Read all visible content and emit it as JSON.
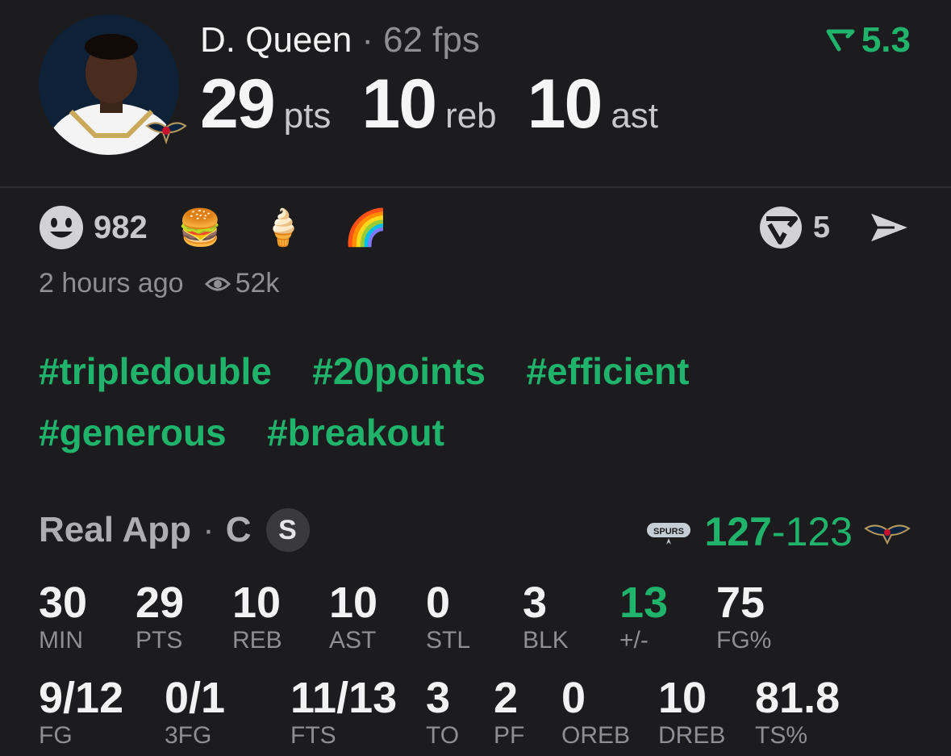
{
  "player": {
    "name": "D. Queen",
    "fps": "62 fps",
    "rating": "5.3",
    "pts": "29",
    "pts_unit": "pts",
    "reb": "10",
    "reb_unit": "reb",
    "ast": "10",
    "ast_unit": "ast"
  },
  "reactions": {
    "count": "982",
    "emojis": [
      "🍔",
      "🍦",
      "🌈"
    ],
    "shares": "5"
  },
  "meta": {
    "time": "2 hours ago",
    "views": "52k"
  },
  "tags": [
    "#tripledouble",
    "#20points",
    "#efficient",
    "#generous",
    "#breakout"
  ],
  "game": {
    "source": "Real App",
    "position": "C",
    "badge": "S",
    "score_home": "127",
    "score_away": "123",
    "spurs_logo_text": "SPURS"
  },
  "stats_row1": [
    {
      "value": "30",
      "label": "MIN"
    },
    {
      "value": "29",
      "label": "PTS"
    },
    {
      "value": "10",
      "label": "REB"
    },
    {
      "value": "10",
      "label": "AST"
    },
    {
      "value": "0",
      "label": "STL"
    },
    {
      "value": "3",
      "label": "BLK"
    },
    {
      "value": "13",
      "label": "+/-"
    },
    {
      "value": "75",
      "label": "FG%"
    }
  ],
  "stats_row2": [
    {
      "value": "9/12",
      "label": "FG"
    },
    {
      "value": "0/1",
      "label": "3FG"
    },
    {
      "value": "11/13",
      "label": "FTS"
    },
    {
      "value": "3",
      "label": "TO"
    },
    {
      "value": "2",
      "label": "PF"
    },
    {
      "value": "0",
      "label": "OREB"
    },
    {
      "value": "10",
      "label": "DREB"
    },
    {
      "value": "81.8",
      "label": "TS%"
    }
  ],
  "colors": {
    "accent": "#1fb36b",
    "background": "#1c1c1e"
  }
}
